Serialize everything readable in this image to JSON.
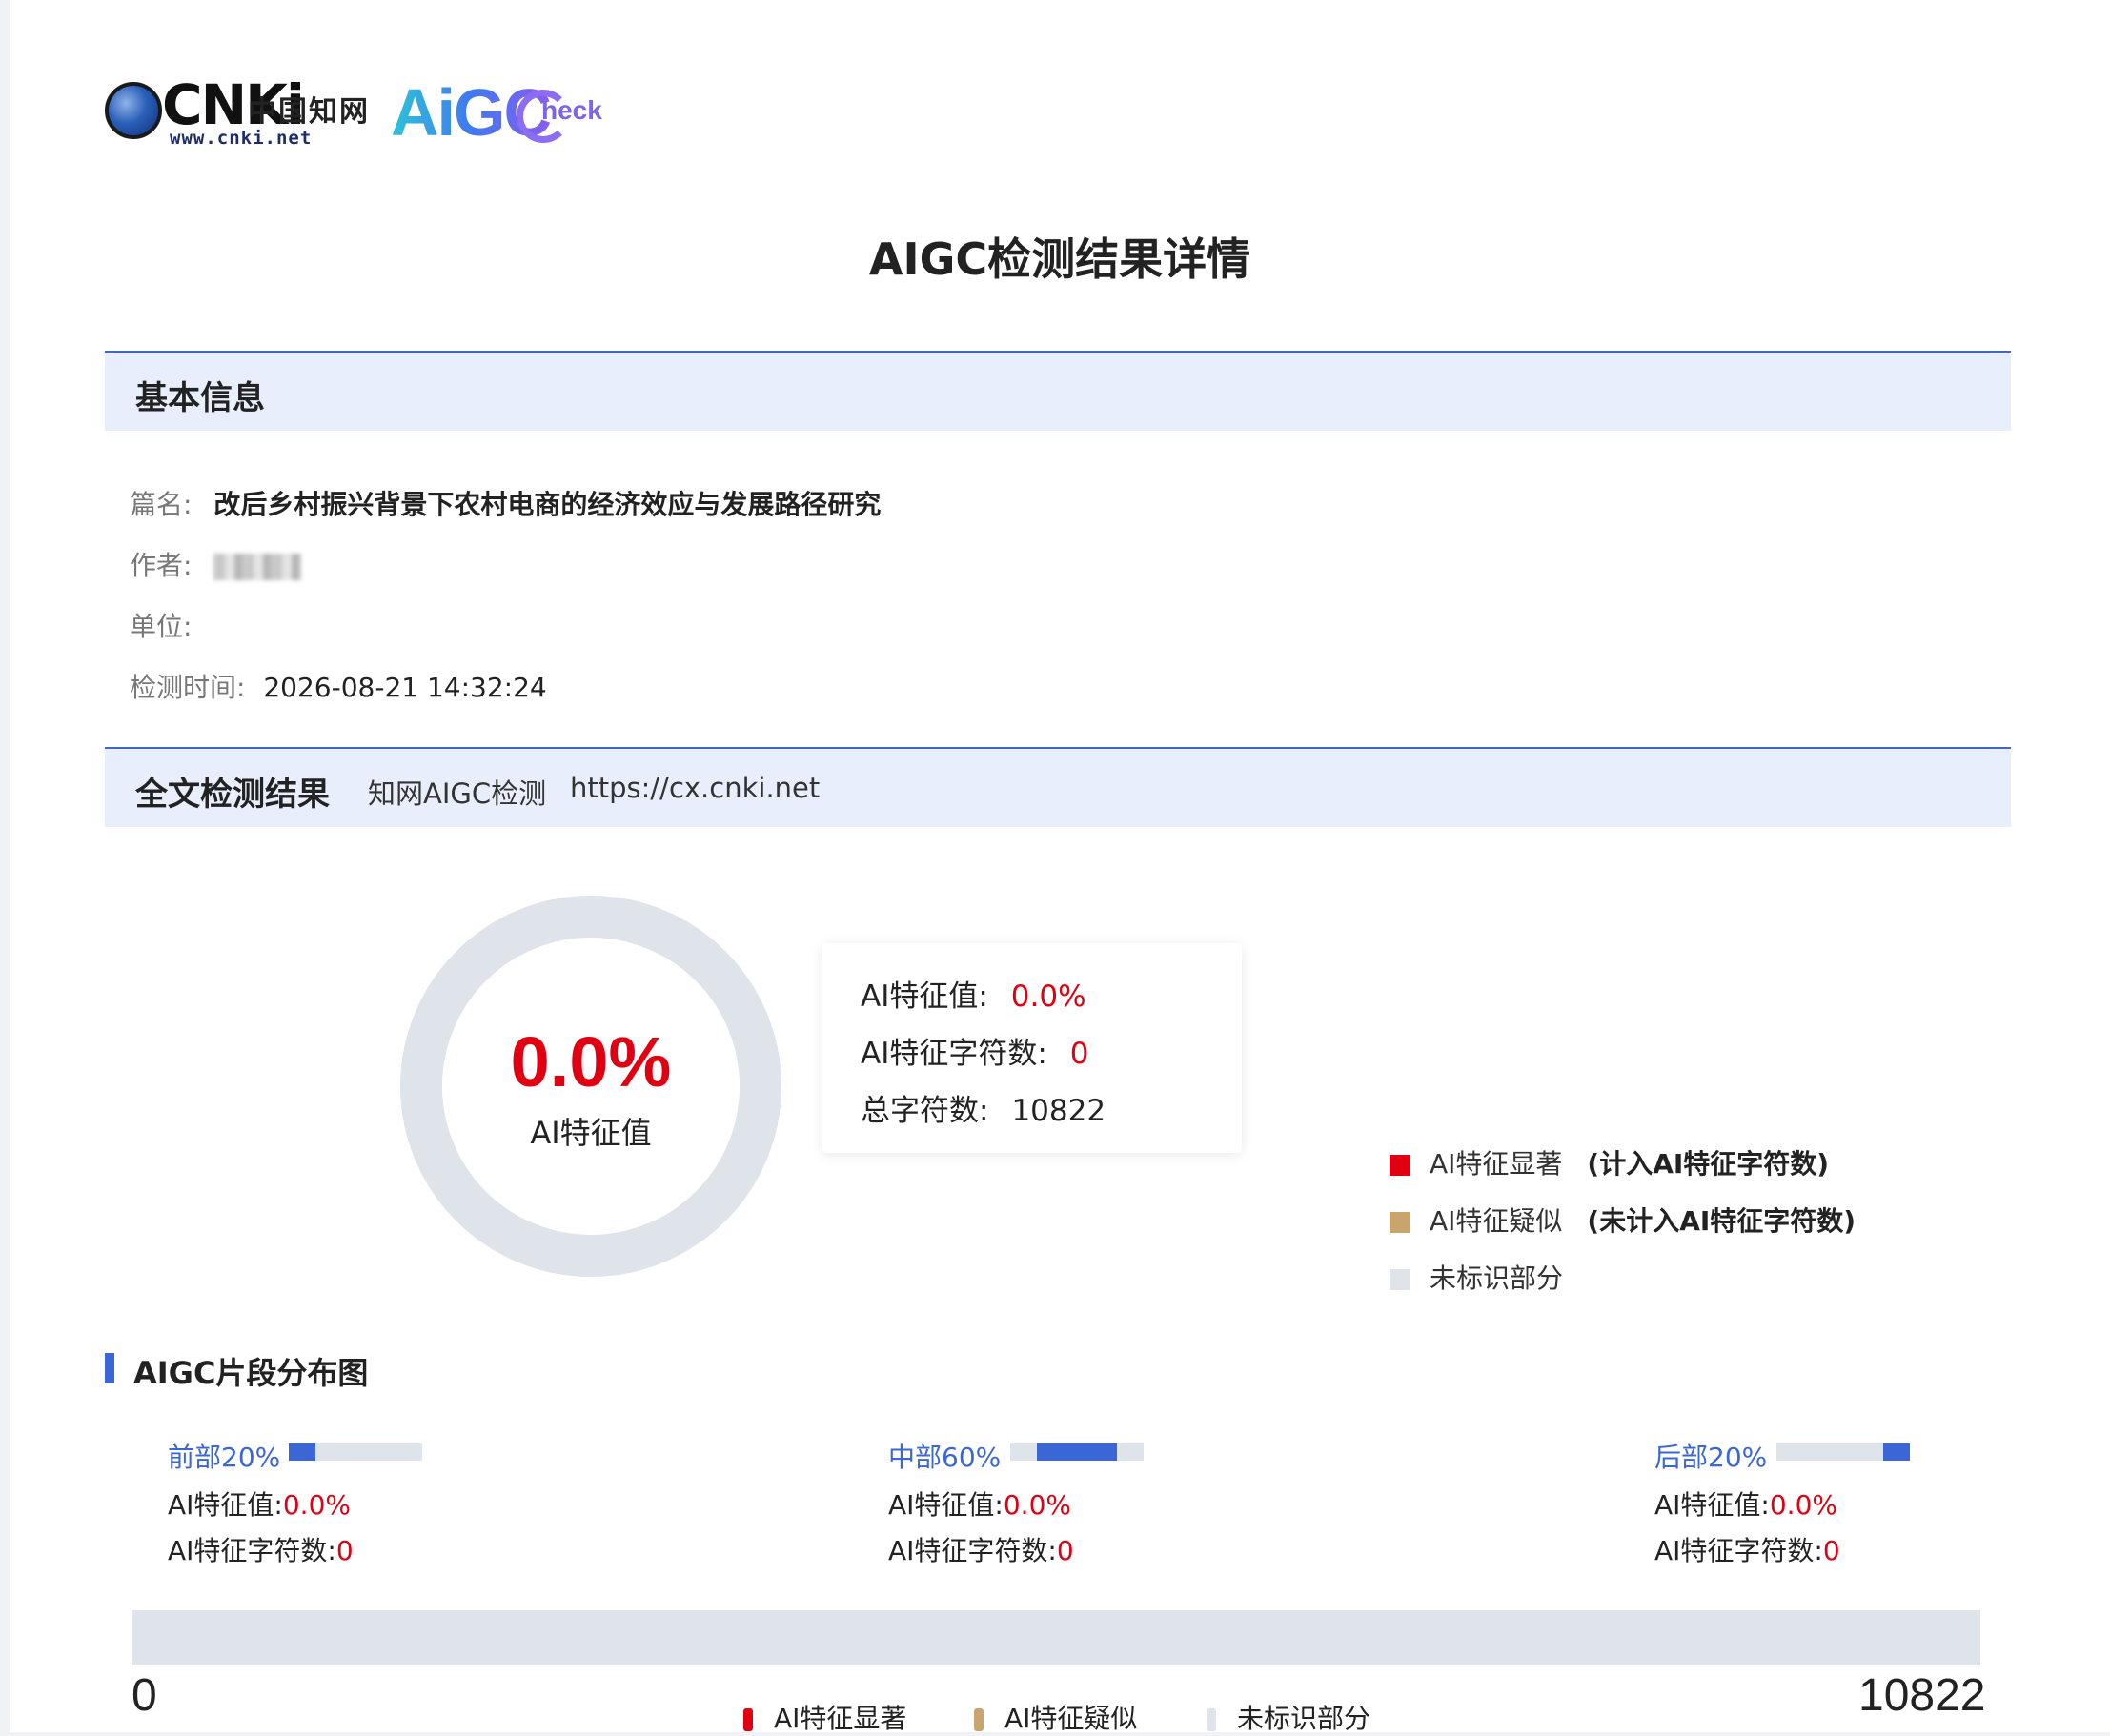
{
  "brand": {
    "cnki_word": "CNKi",
    "cnki_cn": "中国知网",
    "cnki_url": "www.cnki.net",
    "aigc_word": "AiGC",
    "aigc_check": "heck"
  },
  "title": "AIGC检测结果详情",
  "basic_info": {
    "heading": "基本信息",
    "title_label": "篇名:",
    "title_value": "改后乡村振兴背景下农村电商的经济效应与发展路径研究",
    "author_label": "作者:",
    "unit_label": "单位:",
    "time_label": "检测时间:",
    "time_value": "2026-08-21 14:32:24"
  },
  "result": {
    "heading": "全文检测结果",
    "source": "知网AIGC检测",
    "url": "https://cx.cnki.net",
    "donut_value": "0.0%",
    "donut_label": "AI特征值",
    "ai_value_label": "AI特征值:",
    "ai_value": "0.0%",
    "ai_chars_label": "AI特征字符数:",
    "ai_chars": "0",
    "total_label": "总字符数:",
    "total": "10822"
  },
  "legend": [
    {
      "label": "AI特征显著",
      "note": "(计入AI特征字符数)",
      "color": "#e10012"
    },
    {
      "label": "AI特征疑似",
      "note": "(未计入AI特征字符数)",
      "color": "#c9a46c"
    },
    {
      "label": "未标识部分",
      "note": "",
      "color": "#dfe3ea"
    }
  ],
  "distribution": {
    "heading": "AIGC片段分布图",
    "segments": [
      {
        "name": "前部20%",
        "value_label": "AI特征值:",
        "value": "0.0%",
        "chars_label": "AI特征字符数:",
        "chars": "0",
        "bar_fill_start": 0.0,
        "bar_fill_end": 0.2
      },
      {
        "name": "中部60%",
        "value_label": "AI特征值:",
        "value": "0.0%",
        "chars_label": "AI特征字符数:",
        "chars": "0",
        "bar_fill_start": 0.2,
        "bar_fill_end": 0.8
      },
      {
        "name": "后部20%",
        "value_label": "AI特征值:",
        "value": "0.0%",
        "chars_label": "AI特征字符数:",
        "chars": "0",
        "bar_fill_start": 0.8,
        "bar_fill_end": 1.0
      }
    ],
    "axis_start": "0",
    "axis_end": "10822",
    "bottom_legend": [
      {
        "label": "AI特征显著",
        "color": "#e10012"
      },
      {
        "label": "AI特征疑似",
        "color": "#c9a46c"
      },
      {
        "label": "未标识部分",
        "color": "#dfe3ea"
      }
    ]
  }
}
